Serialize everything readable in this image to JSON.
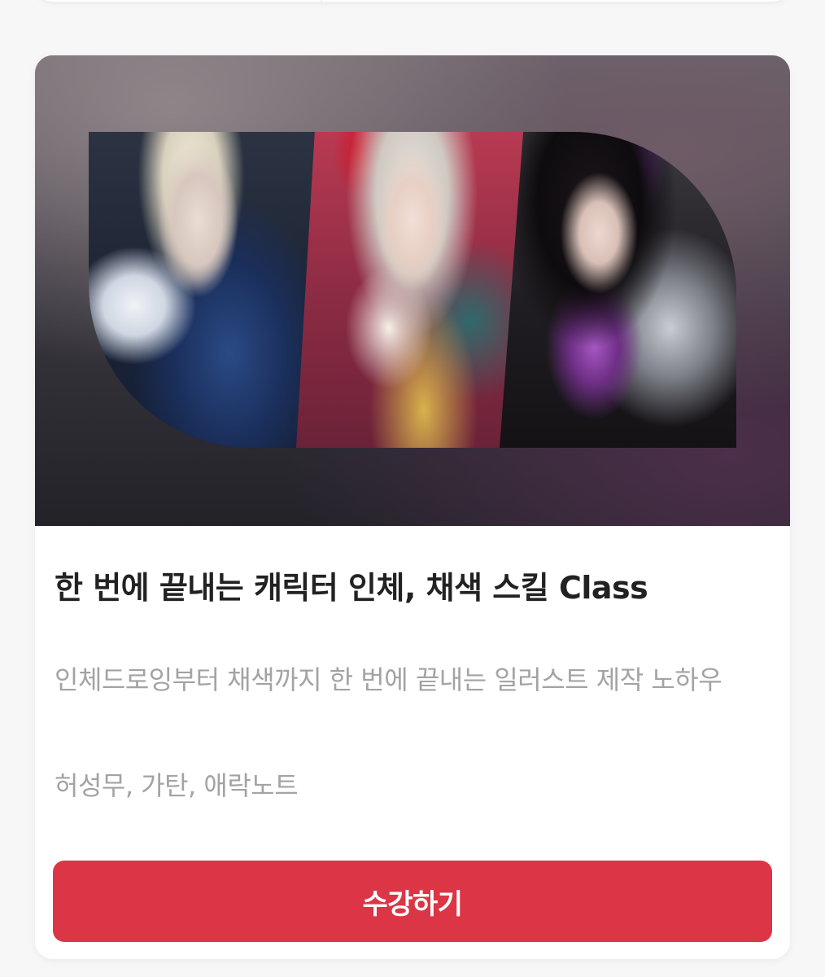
{
  "course": {
    "title": "한 번에 끝내는 캐릭터 인체, 채색 스킬 Class",
    "description": "인체드로잉부터 채색까지 한 번에 끝내는 일러스트 제작 노하우",
    "authors": "허성무, 가탄, 애락노트",
    "enroll_label": "수강하기"
  },
  "colors": {
    "accent": "#dc3545",
    "title_text": "#222222",
    "muted_text": "#a3a3a3",
    "page_background": "#f7f7f8",
    "card_background": "#ffffff"
  }
}
